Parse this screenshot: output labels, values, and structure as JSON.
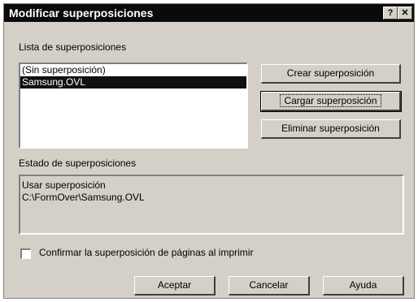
{
  "window": {
    "title": "Modificar superposiciones",
    "help_glyph": "?",
    "close_glyph": "✕"
  },
  "overlay_list": {
    "label": "Lista de superposiciones",
    "items": [
      "(Sin superposición)",
      "Samsung.OVL"
    ],
    "selected_index": 1
  },
  "buttons": {
    "create": "Crear superposición",
    "load": "Cargar superposición",
    "delete": "Eliminar superposición",
    "ok": "Aceptar",
    "cancel": "Cancelar",
    "help": "Ayuda"
  },
  "status": {
    "label": "Estado de superposiciones",
    "lines": [
      "Usar superposición",
      "C:\\FormOver\\Samsung.OVL"
    ]
  },
  "confirm_checkbox": {
    "label": "Confirmar la superposición de páginas al imprimir",
    "checked": false
  }
}
